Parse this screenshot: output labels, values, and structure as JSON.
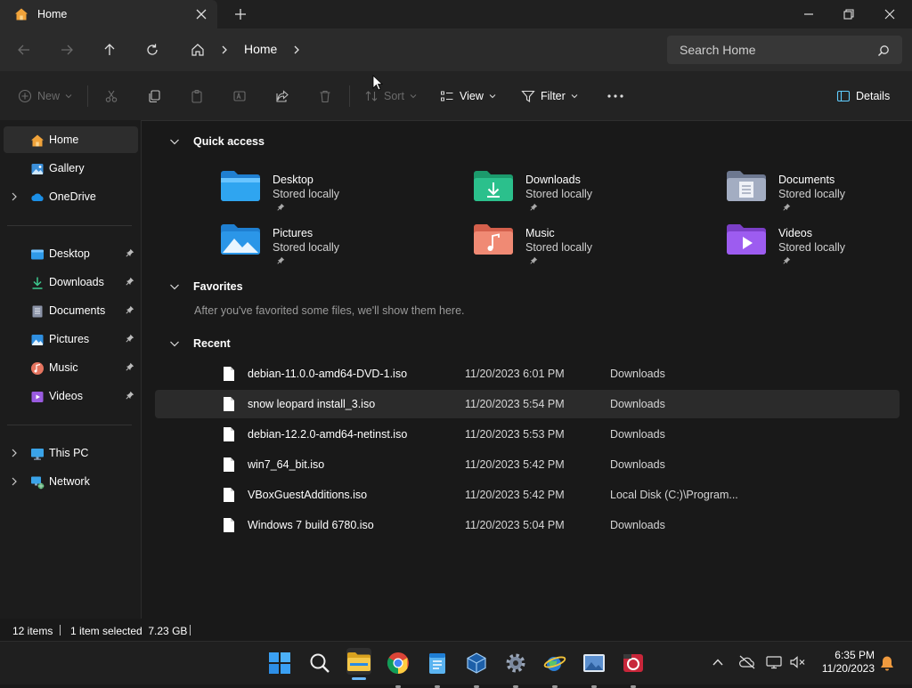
{
  "tab": {
    "title": "Home"
  },
  "nav": {
    "crumbs": [
      "Home"
    ]
  },
  "search": {
    "placeholder": "Search Home"
  },
  "commands": {
    "new": "New",
    "sort": "Sort",
    "view": "View",
    "filter": "Filter",
    "details": "Details"
  },
  "sidebar": {
    "home": "Home",
    "gallery": "Gallery",
    "onedrive": "OneDrive",
    "pinned": [
      "Desktop",
      "Downloads",
      "Documents",
      "Pictures",
      "Music",
      "Videos"
    ],
    "thispc": "This PC",
    "network": "Network"
  },
  "sections": {
    "quick_access": "Quick access",
    "favorites": "Favorites",
    "favorites_empty": "After you've favorited some files, we'll show them here.",
    "recent": "Recent"
  },
  "quick_access": [
    {
      "name": "Desktop",
      "sub": "Stored locally"
    },
    {
      "name": "Downloads",
      "sub": "Stored locally"
    },
    {
      "name": "Documents",
      "sub": "Stored locally"
    },
    {
      "name": "Pictures",
      "sub": "Stored locally"
    },
    {
      "name": "Music",
      "sub": "Stored locally"
    },
    {
      "name": "Videos",
      "sub": "Stored locally"
    }
  ],
  "recent": [
    {
      "name": "debian-11.0.0-amd64-DVD-1.iso",
      "date": "11/20/2023 6:01 PM",
      "location": "Downloads"
    },
    {
      "name": "snow leopard install_3.iso",
      "date": "11/20/2023 5:54 PM",
      "location": "Downloads"
    },
    {
      "name": "debian-12.2.0-amd64-netinst.iso",
      "date": "11/20/2023 5:53 PM",
      "location": "Downloads"
    },
    {
      "name": "win7_64_bit.iso",
      "date": "11/20/2023 5:42 PM",
      "location": "Downloads"
    },
    {
      "name": "VBoxGuestAdditions.iso",
      "date": "11/20/2023 5:42 PM",
      "location": "Local Disk (C:)\\Program..."
    },
    {
      "name": "Windows 7 build 6780.iso",
      "date": "11/20/2023 5:04 PM",
      "location": "Downloads"
    }
  ],
  "status": {
    "items": "12 items",
    "selected": "1 item selected  7.23 GB"
  },
  "clock": {
    "time": "6:35 PM",
    "date": "11/20/2023"
  },
  "colors": {
    "accent": "#60cdff",
    "folder_yellow": "#f4c542"
  }
}
